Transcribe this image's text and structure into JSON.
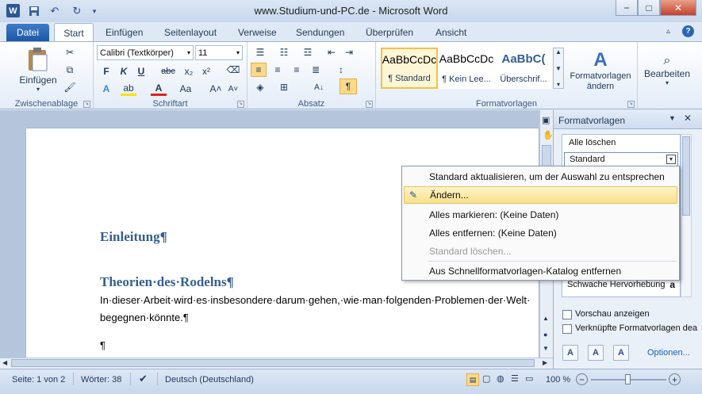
{
  "window": {
    "title": "www.Studium-und-PC.de - Microsoft Word",
    "app_icon": "W",
    "quick_access": [
      "save-icon",
      "undo-icon",
      "redo-icon",
      "customize-icon"
    ],
    "controls": {
      "minimize": "−",
      "maximize": "□",
      "close": "✕"
    }
  },
  "tabs": [
    "Datei",
    "Start",
    "Einfügen",
    "Seitenlayout",
    "Verweise",
    "Sendungen",
    "Überprüfen",
    "Ansicht"
  ],
  "ribbon": {
    "clipboard": {
      "paste_label": "Einfügen",
      "group_label": "Zwischenablage"
    },
    "font": {
      "font_name": "Calibri (Textkörper)",
      "font_size": "11",
      "group_label": "Schriftart",
      "buttons": [
        "F",
        "K",
        "U",
        "abc",
        "x₂",
        "x²"
      ]
    },
    "paragraph": {
      "group_label": "Absatz"
    },
    "styles": {
      "group_label": "Formatvorlagen",
      "tiles": [
        {
          "sample": "AaBbCcDc",
          "name": "¶ Standard"
        },
        {
          "sample": "AaBbCcDc",
          "name": "¶ Kein Lee..."
        },
        {
          "sample": "AaBbC(",
          "name": "Überschrif..."
        }
      ],
      "change_styles": "Formatvorlagen ändern"
    },
    "editing": {
      "label": "Bearbeiten"
    }
  },
  "document": {
    "heading1": "Einleitung¶",
    "heading2": "Theorien·des·Rodelns¶",
    "para_line1": "In·dieser·Arbeit·wird·es·insbesondere·darum·gehen,·wie·man·folgenden·Problemen·der·Welt·",
    "para_line2": "begegnen·könnte.¶",
    "empty_para": "¶"
  },
  "pane": {
    "title": "Formatvorlagen",
    "clear_all": "Alle löschen",
    "selected_style": "Standard",
    "visible_style": "Schwache Hervorhebung",
    "visible_style_icon": "a",
    "preview_label": "Vorschau anzeigen",
    "linked_label": "Verknüpfte Formatvorlagen dea",
    "options_link": "Optionen..."
  },
  "context_menu": {
    "items": [
      {
        "label": "Standard aktualisieren, um der Auswahl zu entsprechen",
        "state": "normal"
      },
      {
        "label": "Ändern...",
        "state": "highlighted"
      },
      {
        "label": "Alles markieren: (Keine Daten)",
        "state": "normal"
      },
      {
        "label": "Alles entfernen: (Keine Daten)",
        "state": "normal"
      },
      {
        "label": "Standard löschen...",
        "state": "disabled"
      },
      {
        "label": "Aus Schnellformatvorlagen-Katalog entfernen",
        "state": "normal"
      }
    ]
  },
  "statusbar": {
    "page": "Seite: 1 von 2",
    "words": "Wörter: 38",
    "language": "Deutsch (Deutschland)",
    "zoom": "100 %",
    "zoom_level": 100
  },
  "colors": {
    "accent": "#1c58a6",
    "heading": "#365f91",
    "highlight": "#f9e08a"
  }
}
